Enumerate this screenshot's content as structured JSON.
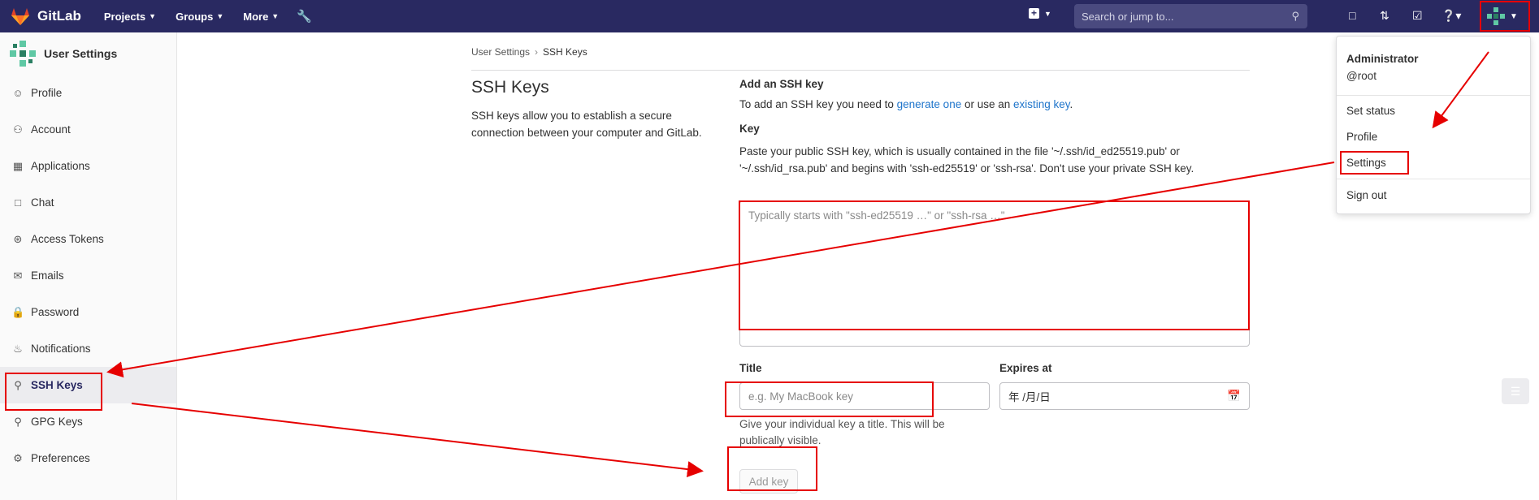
{
  "topbar": {
    "brand": "GitLab",
    "nav": [
      {
        "label": "Projects"
      },
      {
        "label": "Groups"
      },
      {
        "label": "More"
      }
    ],
    "search_placeholder": "Search or jump to..."
  },
  "sidebar": {
    "title": "User Settings",
    "items": [
      {
        "label": "Profile",
        "icon": "profile-icon"
      },
      {
        "label": "Account",
        "icon": "account-icon"
      },
      {
        "label": "Applications",
        "icon": "applications-icon"
      },
      {
        "label": "Chat",
        "icon": "chat-icon"
      },
      {
        "label": "Access Tokens",
        "icon": "token-icon"
      },
      {
        "label": "Emails",
        "icon": "mail-icon"
      },
      {
        "label": "Password",
        "icon": "lock-icon"
      },
      {
        "label": "Notifications",
        "icon": "bell-icon"
      },
      {
        "label": "SSH Keys",
        "icon": "key-icon"
      },
      {
        "label": "GPG Keys",
        "icon": "key-icon"
      },
      {
        "label": "Preferences",
        "icon": "preferences-icon"
      }
    ]
  },
  "breadcrumb": {
    "parent": "User Settings",
    "current": "SSH Keys"
  },
  "page": {
    "title": "SSH Keys",
    "description": "SSH keys allow you to establish a secure connection between your computer and GitLab."
  },
  "form": {
    "heading": "Add an SSH key",
    "intro_prefix": "To add an SSH key you need to ",
    "intro_link1": "generate one",
    "intro_mid": " or use an ",
    "intro_link2": "existing key",
    "intro_suffix": ".",
    "key_label": "Key",
    "key_help": "Paste your public SSH key, which is usually contained in the file '~/.ssh/id_ed25519.pub' or '~/.ssh/id_rsa.pub' and begins with 'ssh-ed25519' or 'ssh-rsa'. Don't use your private SSH key.",
    "key_placeholder": "Typically starts with \"ssh-ed25519 …\" or \"ssh-rsa …\"",
    "title_label": "Title",
    "title_placeholder": "e.g. My MacBook key",
    "title_help": "Give your individual key a title. This will be publically visible.",
    "expires_label": "Expires at",
    "expires_value": "年 /月/日",
    "submit": "Add key"
  },
  "user_menu": {
    "name": "Administrator",
    "username": "@root",
    "items": [
      "Set status",
      "Profile",
      "Settings",
      "Sign out"
    ]
  },
  "colors": {
    "header": "#292961",
    "link": "#1f75cb",
    "annotation": "#e60000"
  }
}
